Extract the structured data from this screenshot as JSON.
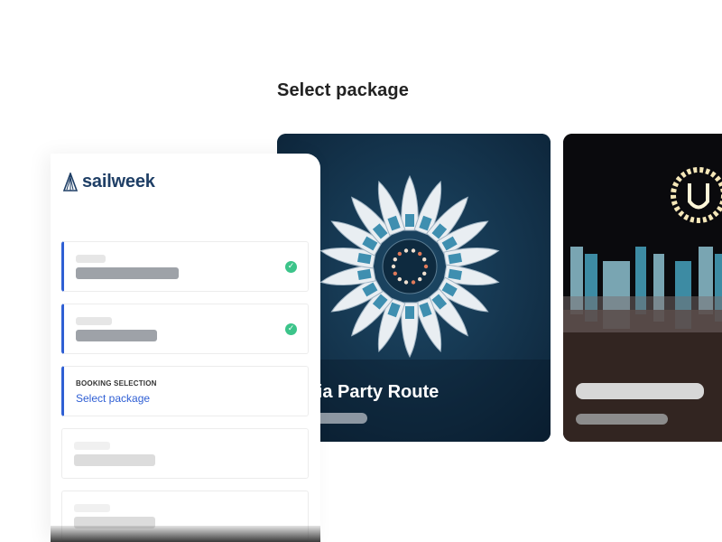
{
  "page": {
    "title": "Select package"
  },
  "packages": [
    {
      "title": "atia Party Route"
    },
    {
      "title": ""
    }
  ],
  "sidebar": {
    "logo_text": "sailweek",
    "steps": [
      {
        "status": "completed"
      },
      {
        "status": "completed"
      },
      {
        "status": "current",
        "label": "BOOKING SELECTION",
        "value": "Select package"
      },
      {
        "status": "pending"
      },
      {
        "status": "pending"
      }
    ]
  },
  "colors": {
    "accent": "#2f5fd4",
    "success": "#3cc48a",
    "logo": "#1f3f66"
  }
}
